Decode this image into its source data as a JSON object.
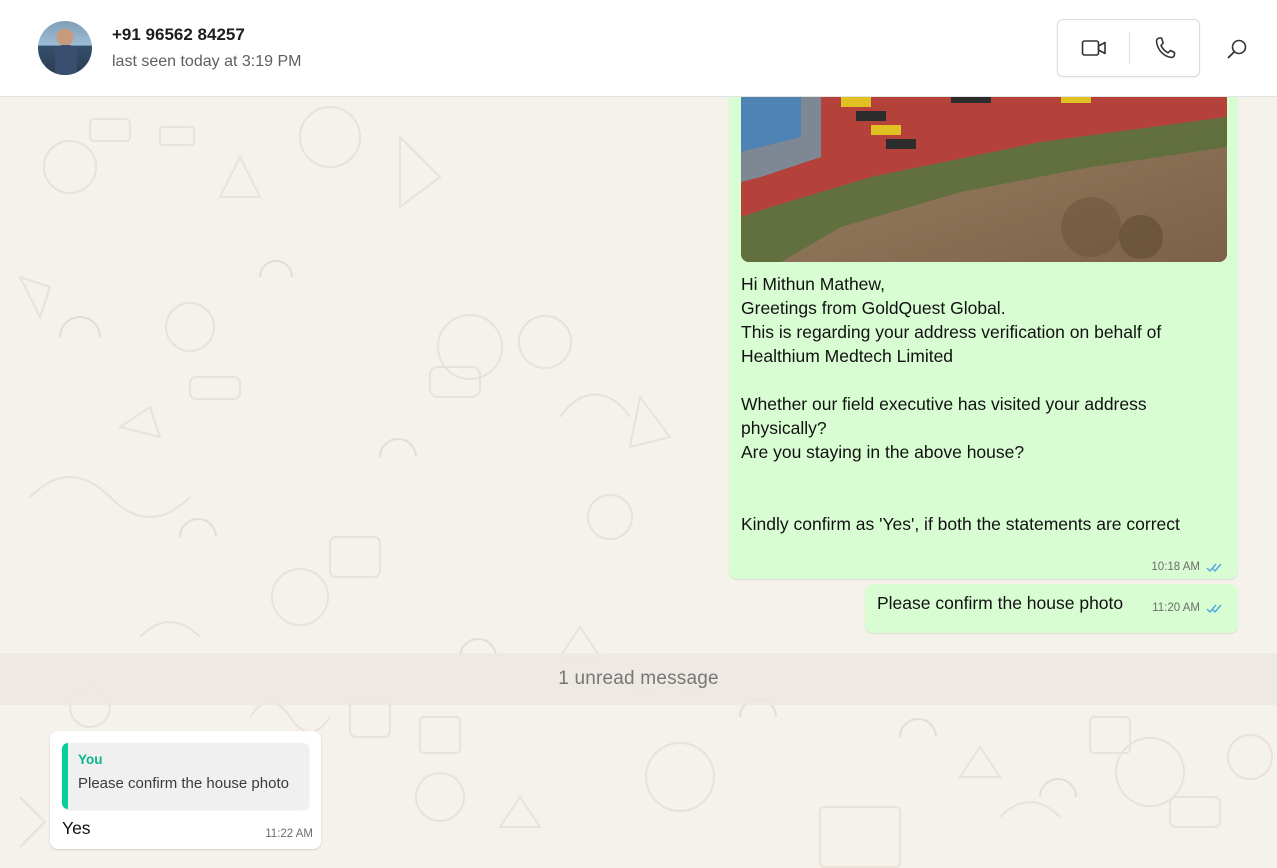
{
  "header": {
    "contact_name": "+91 96562 84257",
    "last_seen": "last seen today at 3:19 PM",
    "icons": {
      "video_call": "video-camera-icon",
      "voice_call": "phone-icon",
      "search": "search-icon",
      "avatar": "contact-avatar"
    }
  },
  "messages": {
    "photo_message": {
      "text": "Hi Mithun Mathew,\nGreetings from GoldQuest Global.\nThis is regarding your address verification on behalf of Healthium Medtech Limited\n\nWhether our field executive has visited your address physically?\nAre you staying in the above house?\n\n\nKindly confirm as 'Yes', if both the statements are correct",
      "time": "10:18 AM",
      "status_icon": "double-check-icon"
    },
    "confirm_message": {
      "text": "Please confirm the house photo",
      "time": "11:20 AM",
      "status_icon": "double-check-icon"
    },
    "unread_divider": "1 unread message",
    "reply_message": {
      "quote_author": "You",
      "quote_text": "Please confirm the house photo",
      "text": "Yes",
      "time": "11:22 AM"
    }
  },
  "colors": {
    "outgoing_bubble": "#d9fdd3",
    "incoming_bubble": "#ffffff",
    "quote_accent": "#06cf9c",
    "read_tick": "#53a6e2",
    "chat_background": "#f5f1eb"
  }
}
